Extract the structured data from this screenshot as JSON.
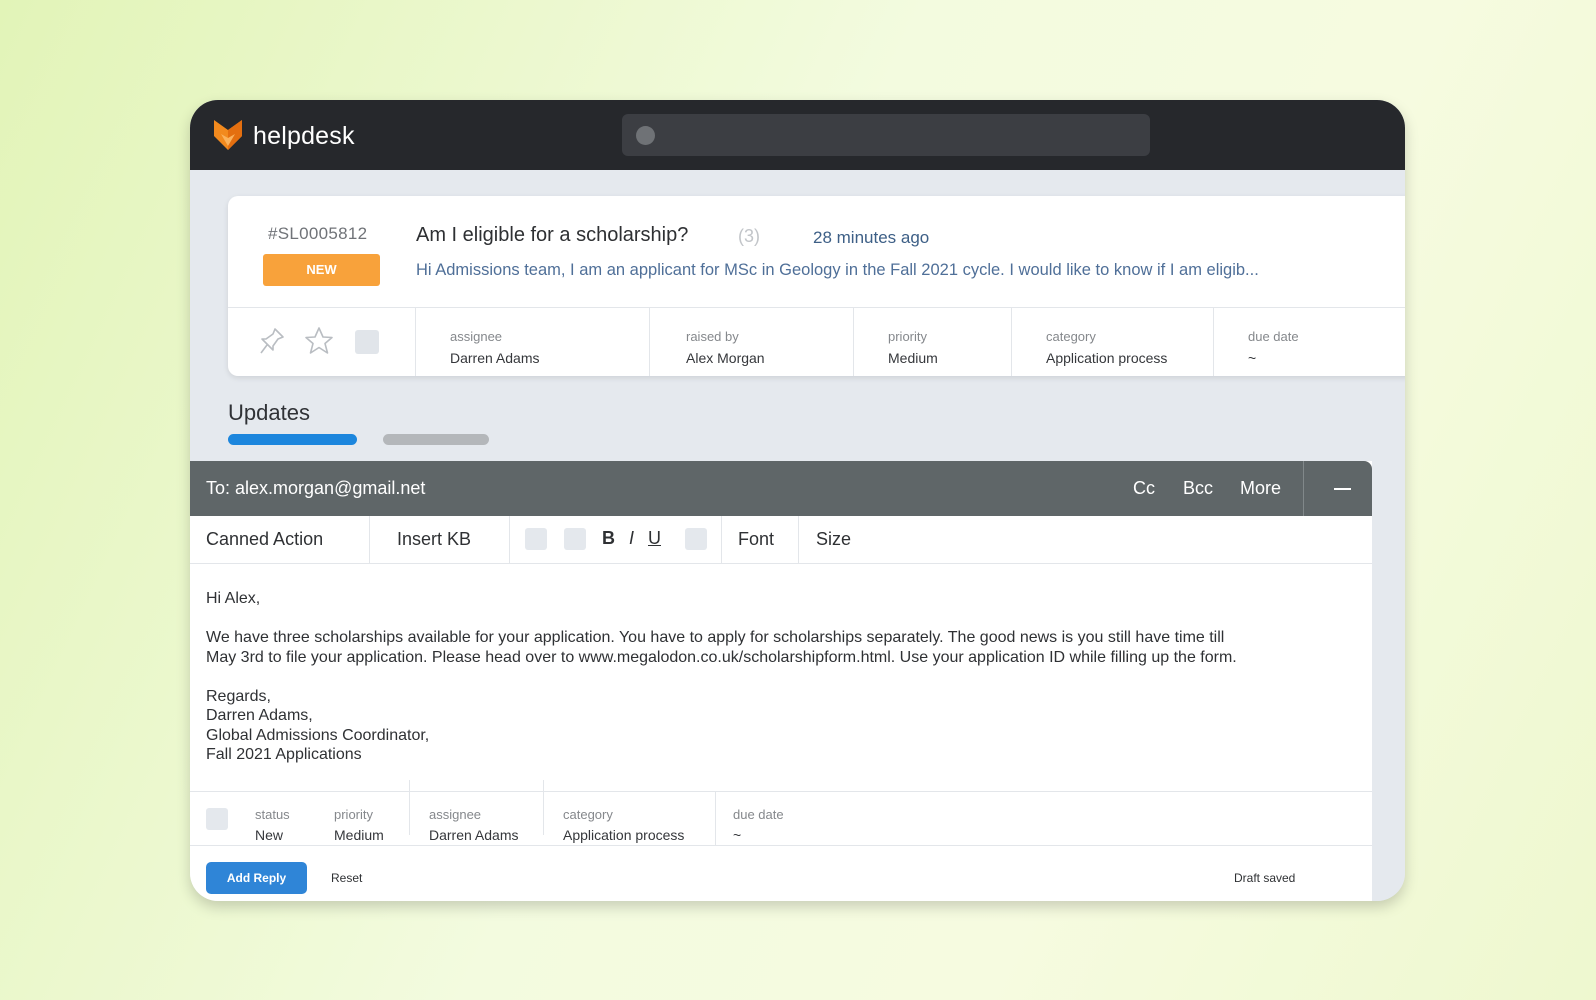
{
  "app": {
    "brand": "helpdesk",
    "logo_icon": "fox-logo-icon",
    "accent": "#f28a1e"
  },
  "search": {
    "placeholder": ""
  },
  "ticket": {
    "id": "#SL0005812",
    "status_badge": "NEW",
    "title": "Am I eligible for a scholarship?",
    "count": "(3)",
    "time": "28 minutes ago",
    "snippet": "Hi Admissions team, I am an applicant for MSc in Geology in the Fall 2021 cycle. I would like to know if I am eligib...",
    "icons": [
      "pin-icon",
      "star-icon",
      "checkbox"
    ],
    "meta": [
      {
        "label": "assignee",
        "value": "Darren Adams"
      },
      {
        "label": "raised by",
        "value": "Alex Morgan"
      },
      {
        "label": "priority",
        "value": "Medium"
      },
      {
        "label": "category",
        "value": "Application process"
      },
      {
        "label": "due date",
        "value": "~"
      }
    ]
  },
  "updates": {
    "title": "Updates"
  },
  "compose": {
    "to": "To: alex.morgan@gmail.net",
    "cc": "Cc",
    "bcc": "Bcc",
    "more": "More",
    "toolbar": {
      "canned_action": "Canned Action",
      "insert_kb": "Insert KB",
      "bold": "B",
      "italic": "I",
      "underline": "U",
      "font": "Font",
      "size": "Size"
    },
    "body": "Hi Alex,\n\nWe have three scholarships available for your application. You have to apply for scholarships separately. The good news is you still have time till\nMay 3rd to file your application. Please head over to www.megalodon.co.uk/scholarshipform.html. Use your application ID while filling up the form.\n\nRegards,\nDarren Adams,\nGlobal Admissions Coordinator,\nFall 2021 Applications",
    "fields": [
      {
        "label": "status",
        "value": "New"
      },
      {
        "label": "priority",
        "value": "Medium"
      },
      {
        "label": "assignee",
        "value": "Darren Adams"
      },
      {
        "label": "category",
        "value": "Application process"
      },
      {
        "label": "due date",
        "value": "~"
      }
    ],
    "add_reply": "Add Reply",
    "reset": "Reset",
    "draft_status": "Draft saved"
  },
  "colors": {
    "badge": "#f8a23b",
    "primary": "#2f85d7",
    "header": "#26282c",
    "compose_header": "#5f6668"
  }
}
